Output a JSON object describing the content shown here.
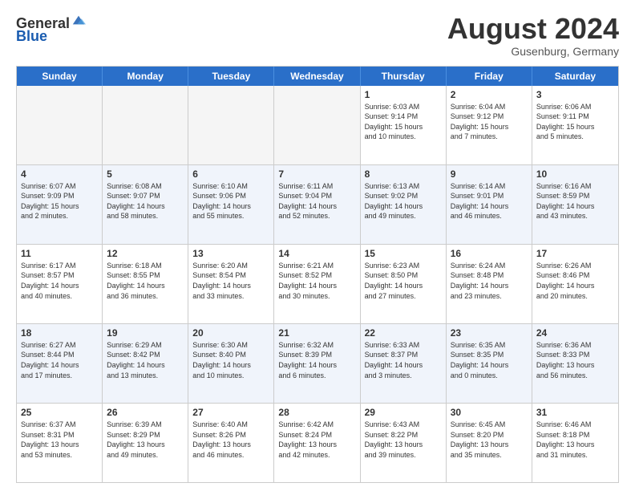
{
  "header": {
    "logo_general": "General",
    "logo_blue": "Blue",
    "month_title": "August 2024",
    "location": "Gusenburg, Germany"
  },
  "calendar": {
    "days_of_week": [
      "Sunday",
      "Monday",
      "Tuesday",
      "Wednesday",
      "Thursday",
      "Friday",
      "Saturday"
    ],
    "rows": [
      {
        "alt": false,
        "cells": [
          {
            "empty": true,
            "day": "",
            "info": ""
          },
          {
            "empty": true,
            "day": "",
            "info": ""
          },
          {
            "empty": true,
            "day": "",
            "info": ""
          },
          {
            "empty": true,
            "day": "",
            "info": ""
          },
          {
            "empty": false,
            "day": "1",
            "info": "Sunrise: 6:03 AM\nSunset: 9:14 PM\nDaylight: 15 hours\nand 10 minutes."
          },
          {
            "empty": false,
            "day": "2",
            "info": "Sunrise: 6:04 AM\nSunset: 9:12 PM\nDaylight: 15 hours\nand 7 minutes."
          },
          {
            "empty": false,
            "day": "3",
            "info": "Sunrise: 6:06 AM\nSunset: 9:11 PM\nDaylight: 15 hours\nand 5 minutes."
          }
        ]
      },
      {
        "alt": true,
        "cells": [
          {
            "empty": false,
            "day": "4",
            "info": "Sunrise: 6:07 AM\nSunset: 9:09 PM\nDaylight: 15 hours\nand 2 minutes."
          },
          {
            "empty": false,
            "day": "5",
            "info": "Sunrise: 6:08 AM\nSunset: 9:07 PM\nDaylight: 14 hours\nand 58 minutes."
          },
          {
            "empty": false,
            "day": "6",
            "info": "Sunrise: 6:10 AM\nSunset: 9:06 PM\nDaylight: 14 hours\nand 55 minutes."
          },
          {
            "empty": false,
            "day": "7",
            "info": "Sunrise: 6:11 AM\nSunset: 9:04 PM\nDaylight: 14 hours\nand 52 minutes."
          },
          {
            "empty": false,
            "day": "8",
            "info": "Sunrise: 6:13 AM\nSunset: 9:02 PM\nDaylight: 14 hours\nand 49 minutes."
          },
          {
            "empty": false,
            "day": "9",
            "info": "Sunrise: 6:14 AM\nSunset: 9:01 PM\nDaylight: 14 hours\nand 46 minutes."
          },
          {
            "empty": false,
            "day": "10",
            "info": "Sunrise: 6:16 AM\nSunset: 8:59 PM\nDaylight: 14 hours\nand 43 minutes."
          }
        ]
      },
      {
        "alt": false,
        "cells": [
          {
            "empty": false,
            "day": "11",
            "info": "Sunrise: 6:17 AM\nSunset: 8:57 PM\nDaylight: 14 hours\nand 40 minutes."
          },
          {
            "empty": false,
            "day": "12",
            "info": "Sunrise: 6:18 AM\nSunset: 8:55 PM\nDaylight: 14 hours\nand 36 minutes."
          },
          {
            "empty": false,
            "day": "13",
            "info": "Sunrise: 6:20 AM\nSunset: 8:54 PM\nDaylight: 14 hours\nand 33 minutes."
          },
          {
            "empty": false,
            "day": "14",
            "info": "Sunrise: 6:21 AM\nSunset: 8:52 PM\nDaylight: 14 hours\nand 30 minutes."
          },
          {
            "empty": false,
            "day": "15",
            "info": "Sunrise: 6:23 AM\nSunset: 8:50 PM\nDaylight: 14 hours\nand 27 minutes."
          },
          {
            "empty": false,
            "day": "16",
            "info": "Sunrise: 6:24 AM\nSunset: 8:48 PM\nDaylight: 14 hours\nand 23 minutes."
          },
          {
            "empty": false,
            "day": "17",
            "info": "Sunrise: 6:26 AM\nSunset: 8:46 PM\nDaylight: 14 hours\nand 20 minutes."
          }
        ]
      },
      {
        "alt": true,
        "cells": [
          {
            "empty": false,
            "day": "18",
            "info": "Sunrise: 6:27 AM\nSunset: 8:44 PM\nDaylight: 14 hours\nand 17 minutes."
          },
          {
            "empty": false,
            "day": "19",
            "info": "Sunrise: 6:29 AM\nSunset: 8:42 PM\nDaylight: 14 hours\nand 13 minutes."
          },
          {
            "empty": false,
            "day": "20",
            "info": "Sunrise: 6:30 AM\nSunset: 8:40 PM\nDaylight: 14 hours\nand 10 minutes."
          },
          {
            "empty": false,
            "day": "21",
            "info": "Sunrise: 6:32 AM\nSunset: 8:39 PM\nDaylight: 14 hours\nand 6 minutes."
          },
          {
            "empty": false,
            "day": "22",
            "info": "Sunrise: 6:33 AM\nSunset: 8:37 PM\nDaylight: 14 hours\nand 3 minutes."
          },
          {
            "empty": false,
            "day": "23",
            "info": "Sunrise: 6:35 AM\nSunset: 8:35 PM\nDaylight: 14 hours\nand 0 minutes."
          },
          {
            "empty": false,
            "day": "24",
            "info": "Sunrise: 6:36 AM\nSunset: 8:33 PM\nDaylight: 13 hours\nand 56 minutes."
          }
        ]
      },
      {
        "alt": false,
        "cells": [
          {
            "empty": false,
            "day": "25",
            "info": "Sunrise: 6:37 AM\nSunset: 8:31 PM\nDaylight: 13 hours\nand 53 minutes."
          },
          {
            "empty": false,
            "day": "26",
            "info": "Sunrise: 6:39 AM\nSunset: 8:29 PM\nDaylight: 13 hours\nand 49 minutes."
          },
          {
            "empty": false,
            "day": "27",
            "info": "Sunrise: 6:40 AM\nSunset: 8:26 PM\nDaylight: 13 hours\nand 46 minutes."
          },
          {
            "empty": false,
            "day": "28",
            "info": "Sunrise: 6:42 AM\nSunset: 8:24 PM\nDaylight: 13 hours\nand 42 minutes."
          },
          {
            "empty": false,
            "day": "29",
            "info": "Sunrise: 6:43 AM\nSunset: 8:22 PM\nDaylight: 13 hours\nand 39 minutes."
          },
          {
            "empty": false,
            "day": "30",
            "info": "Sunrise: 6:45 AM\nSunset: 8:20 PM\nDaylight: 13 hours\nand 35 minutes."
          },
          {
            "empty": false,
            "day": "31",
            "info": "Sunrise: 6:46 AM\nSunset: 8:18 PM\nDaylight: 13 hours\nand 31 minutes."
          }
        ]
      }
    ]
  }
}
